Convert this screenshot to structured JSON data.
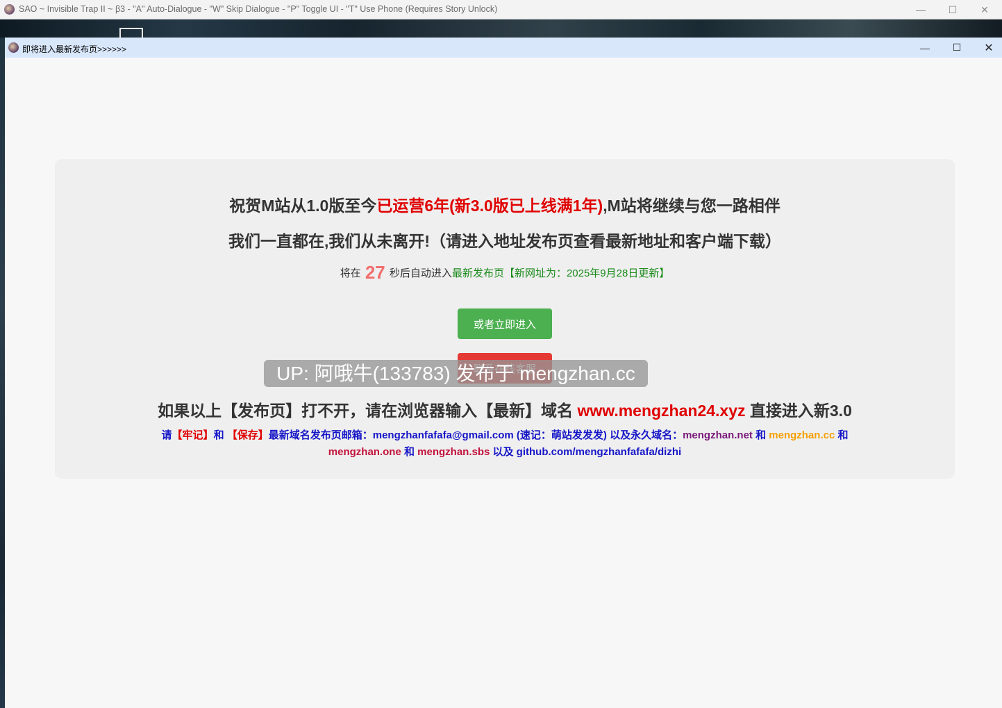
{
  "outer_window": {
    "title": "SAO ~ Invisible Trap II ~ β3 - \"A\" Auto-Dialogue - \"W\" Skip Dialogue - \"P\" Toggle UI - \"T\" Use Phone (Requires Story Unlock)",
    "minimize_glyph": "—",
    "maximize_glyph": "☐",
    "close_glyph": "✕"
  },
  "inner_window": {
    "title": "即将进入最新发布页>>>>>>",
    "minimize_glyph": "—",
    "maximize_glyph": "☐",
    "close_glyph": "✕"
  },
  "card": {
    "line1_a": "祝贺M站从1.0版至今",
    "line1_highlight": "已运营6年(新3.0版已上线满1年)",
    "line1_b": ",M站将继续与您一路相伴",
    "line2": "我们一直都在,我们从未离开!（请进入地址发布页查看最新地址和客户端下载）",
    "countdown_prefix": "将在",
    "countdown_value": "27",
    "countdown_suffix": "秒后自动进入",
    "countdown_target": "最新发布页【新网址为：2025年9月28日更新】",
    "enter_button": "或者立即进入",
    "contact_button": "联系在线客服",
    "line4_a": "如果以上【发布页】打不开，请在浏览器输入【最新】域名",
    "line4_domain": "www.mengzhan24.xyz",
    "line4_b": "直接进入新3.0",
    "line5": {
      "p1": "请",
      "p2": "【牢记】",
      "p3": "和 ",
      "p4": "【保存】",
      "p5": "最新域名发布页邮箱：mengzhanfafafa@gmail.com (速记：萌站发发发) 以及永久域名：",
      "p6": "mengzhan.net",
      "p7": " 和 ",
      "p8": "mengzhan.cc",
      "p9": " 和 ",
      "p10": "mengzhan.one",
      "p11": " 和 ",
      "p12": "mengzhan.sbs",
      "p13": " 以及 github.com/mengzhanfafafa/dizhi"
    }
  },
  "watermark": "UP: 阿哦牛(133783) 发布于 mengzhan.cc",
  "colors": {
    "accent_red": "#e00000",
    "button_green": "#4caf50",
    "button_red": "#e53935",
    "link_blue": "#1515c8",
    "countdown": "#f26d6d"
  }
}
